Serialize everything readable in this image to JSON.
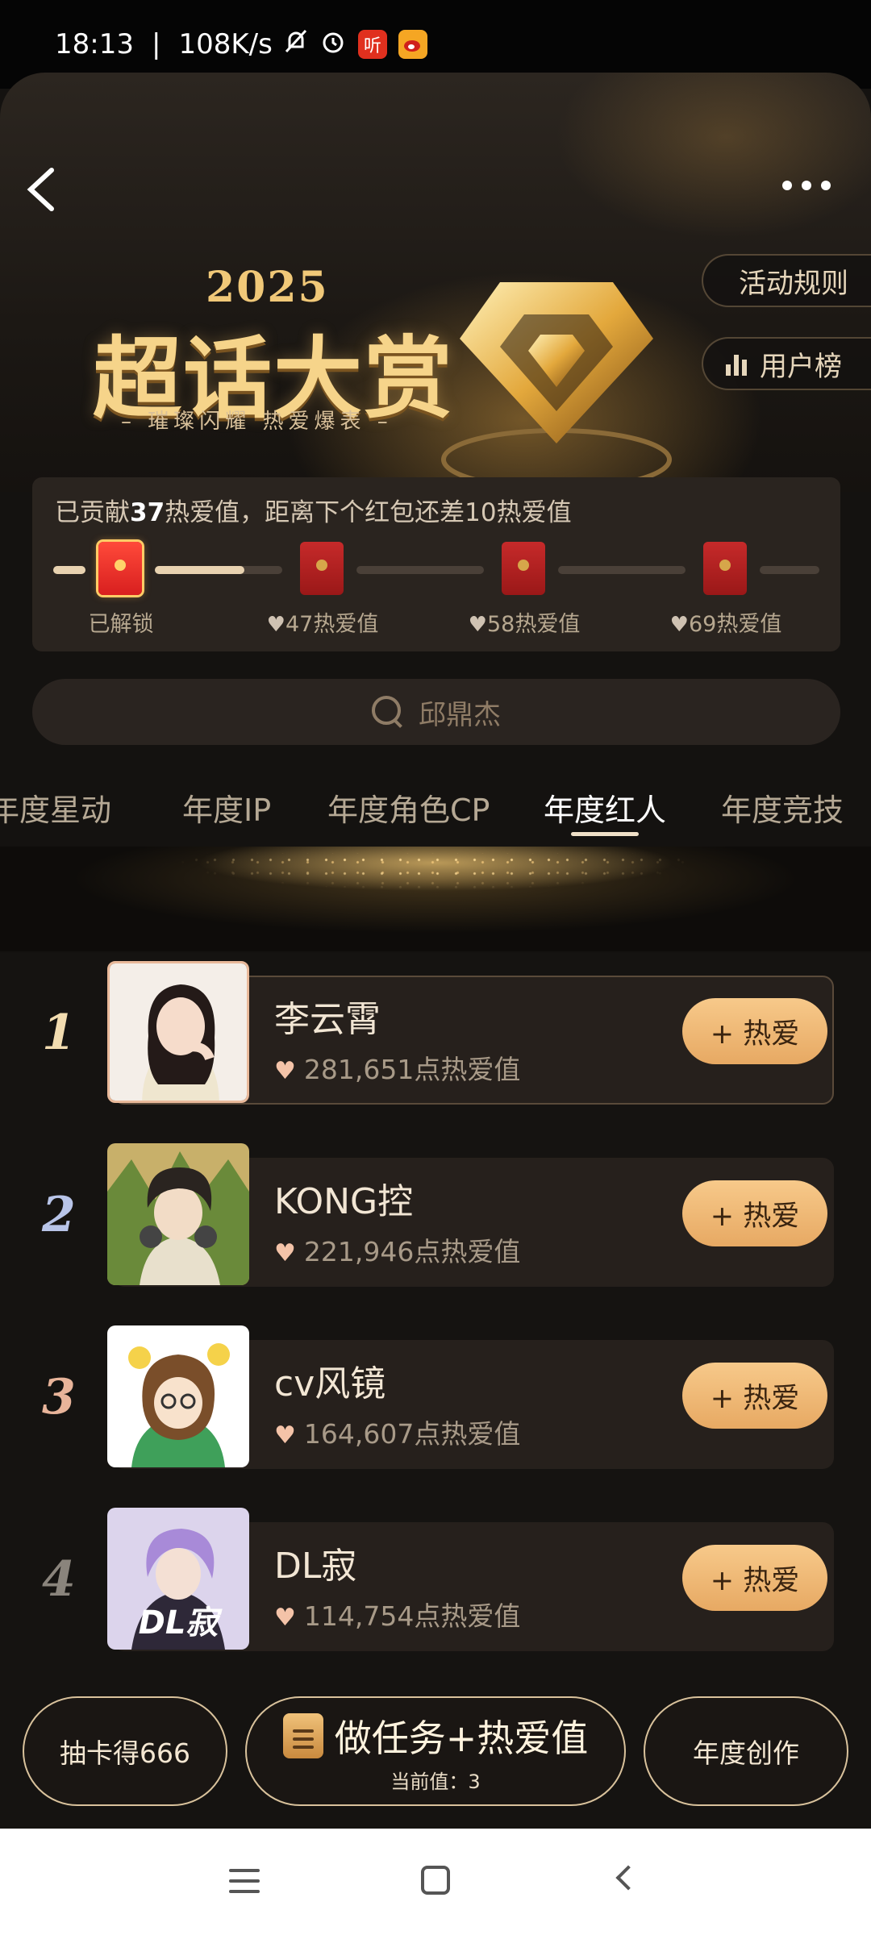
{
  "status_bar": {
    "time": "18:13",
    "separator": "|",
    "speed": "108K/s",
    "icons": [
      "mute-bell-icon",
      "alarm-icon",
      "ting-app-icon",
      "weibo-app-icon"
    ],
    "ting_label": "听"
  },
  "hero": {
    "year": "2025",
    "title": "超话大赏",
    "subtitle": "– 璀璨闪耀 热爱爆表 –",
    "rules_label": "活动规则",
    "user_rank_label": "用户榜"
  },
  "progress": {
    "prefix": "已贡献",
    "contributed": "37",
    "suffix": "热爱值，距离下个红包还差10热爱值",
    "fraction_to_next": 0.7,
    "milestones": [
      {
        "label": "已解锁",
        "unlocked": true
      },
      {
        "label": "47热爱值",
        "unlocked": false
      },
      {
        "label": "58热爱值",
        "unlocked": false
      },
      {
        "label": "69热爱值",
        "unlocked": false
      }
    ]
  },
  "search": {
    "placeholder": "邱鼎杰"
  },
  "tabs": [
    {
      "label": "年度星动",
      "active": false
    },
    {
      "label": "年度IP",
      "active": false
    },
    {
      "label": "年度角色CP",
      "active": false
    },
    {
      "label": "年度红人",
      "active": true
    },
    {
      "label": "年度竞技",
      "active": false
    }
  ],
  "ranking": [
    {
      "rank": "1",
      "name": "李云霄",
      "score": "281,651点热爱值",
      "button": "+ 热爱",
      "rank_color": "#f2dcb0"
    },
    {
      "rank": "2",
      "name": "KONG控",
      "score": "221,946点热爱值",
      "button": "+ 热爱",
      "rank_color": "#b8c4e8"
    },
    {
      "rank": "3",
      "name": "cv风镜",
      "score": "164,607点热爱值",
      "button": "+ 热爱",
      "rank_color": "#e8b49a"
    },
    {
      "rank": "4",
      "name": "DL寂",
      "score": "114,754点热爱值",
      "button": "+ 热爱",
      "rank_color": "#8a847c"
    }
  ],
  "actions": {
    "draw_card": "抽卡得666",
    "task_main": "做任务+热爱值",
    "task_sub": "当前值：3",
    "annual_create": "年度创作"
  },
  "colors": {
    "accent_gold": "#e7a963",
    "background": "#141210"
  }
}
